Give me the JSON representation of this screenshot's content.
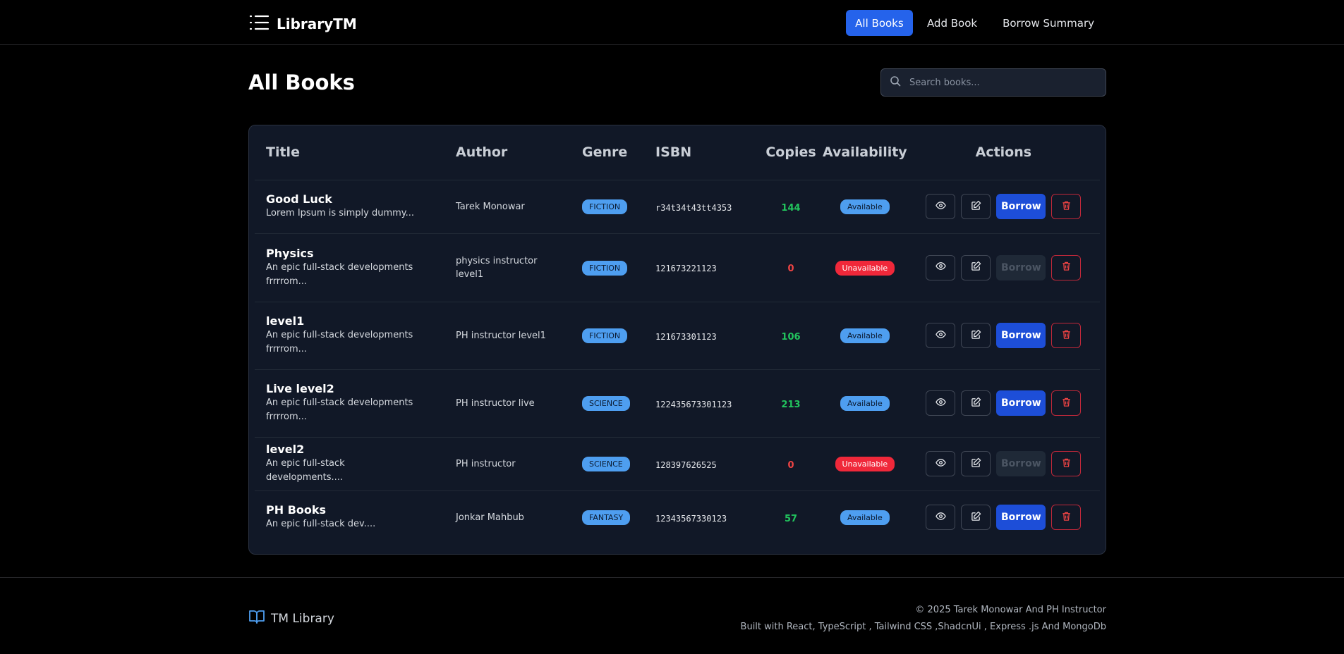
{
  "header": {
    "brand": "LibraryTM",
    "nav": [
      {
        "label": "All Books",
        "active": true
      },
      {
        "label": "Add Book",
        "active": false
      },
      {
        "label": "Borrow Summary",
        "active": false
      }
    ]
  },
  "page": {
    "title": "All Books",
    "search_placeholder": "Search books..."
  },
  "table": {
    "columns": [
      "Title",
      "Author",
      "Genre",
      "ISBN",
      "Copies",
      "Availability",
      "Actions"
    ],
    "borrow_label": "Borrow",
    "rows": [
      {
        "title": "Good Luck",
        "desc": "Lorem Ipsum is simply dummy...",
        "author": "Tarek Monowar",
        "genre": "FICTION",
        "isbn": "r34t34t43tt4353",
        "copies": "144",
        "availability": "Available",
        "available": true
      },
      {
        "title": "Physics",
        "desc": "An epic full-stack developments frrrrom...",
        "author": "physics instructor level1",
        "genre": "FICTION",
        "isbn": "121673221123",
        "copies": "0",
        "availability": "Unavailable",
        "available": false
      },
      {
        "title": "level1",
        "desc": "An epic full-stack developments frrrrom...",
        "author": "PH instructor level1",
        "genre": "FICTION",
        "isbn": "121673301123",
        "copies": "106",
        "availability": "Available",
        "available": true
      },
      {
        "title": "Live level2",
        "desc": "An epic full-stack developments frrrrom...",
        "author": "PH instructor live",
        "genre": "SCIENCE",
        "isbn": "122435673301123",
        "copies": "213",
        "availability": "Available",
        "available": true
      },
      {
        "title": "level2",
        "desc": "An epic full-stack developments....",
        "author": "PH instructor",
        "genre": "SCIENCE",
        "isbn": "128397626525",
        "copies": "0",
        "availability": "Unavailable",
        "available": false
      },
      {
        "title": "PH Books",
        "desc": "An epic full-stack dev....",
        "author": "Jonkar Mahbub",
        "genre": "FANTASY",
        "isbn": "12343567330123",
        "copies": "57",
        "availability": "Available",
        "available": true
      }
    ]
  },
  "footer": {
    "brand": "TM Library",
    "copyright": "© 2025 Tarek Monowar And PH Instructor",
    "built_with": "Built with React, TypeScript , Tailwind CSS ,ShadcnUi , Express .js And MongoDb"
  },
  "colors": {
    "accent": "#2563eb",
    "available_badge": "#4e9ef0",
    "unavailable_badge": "#f0283a",
    "copies_positive": "#22c55e",
    "copies_zero": "#ef4444"
  }
}
